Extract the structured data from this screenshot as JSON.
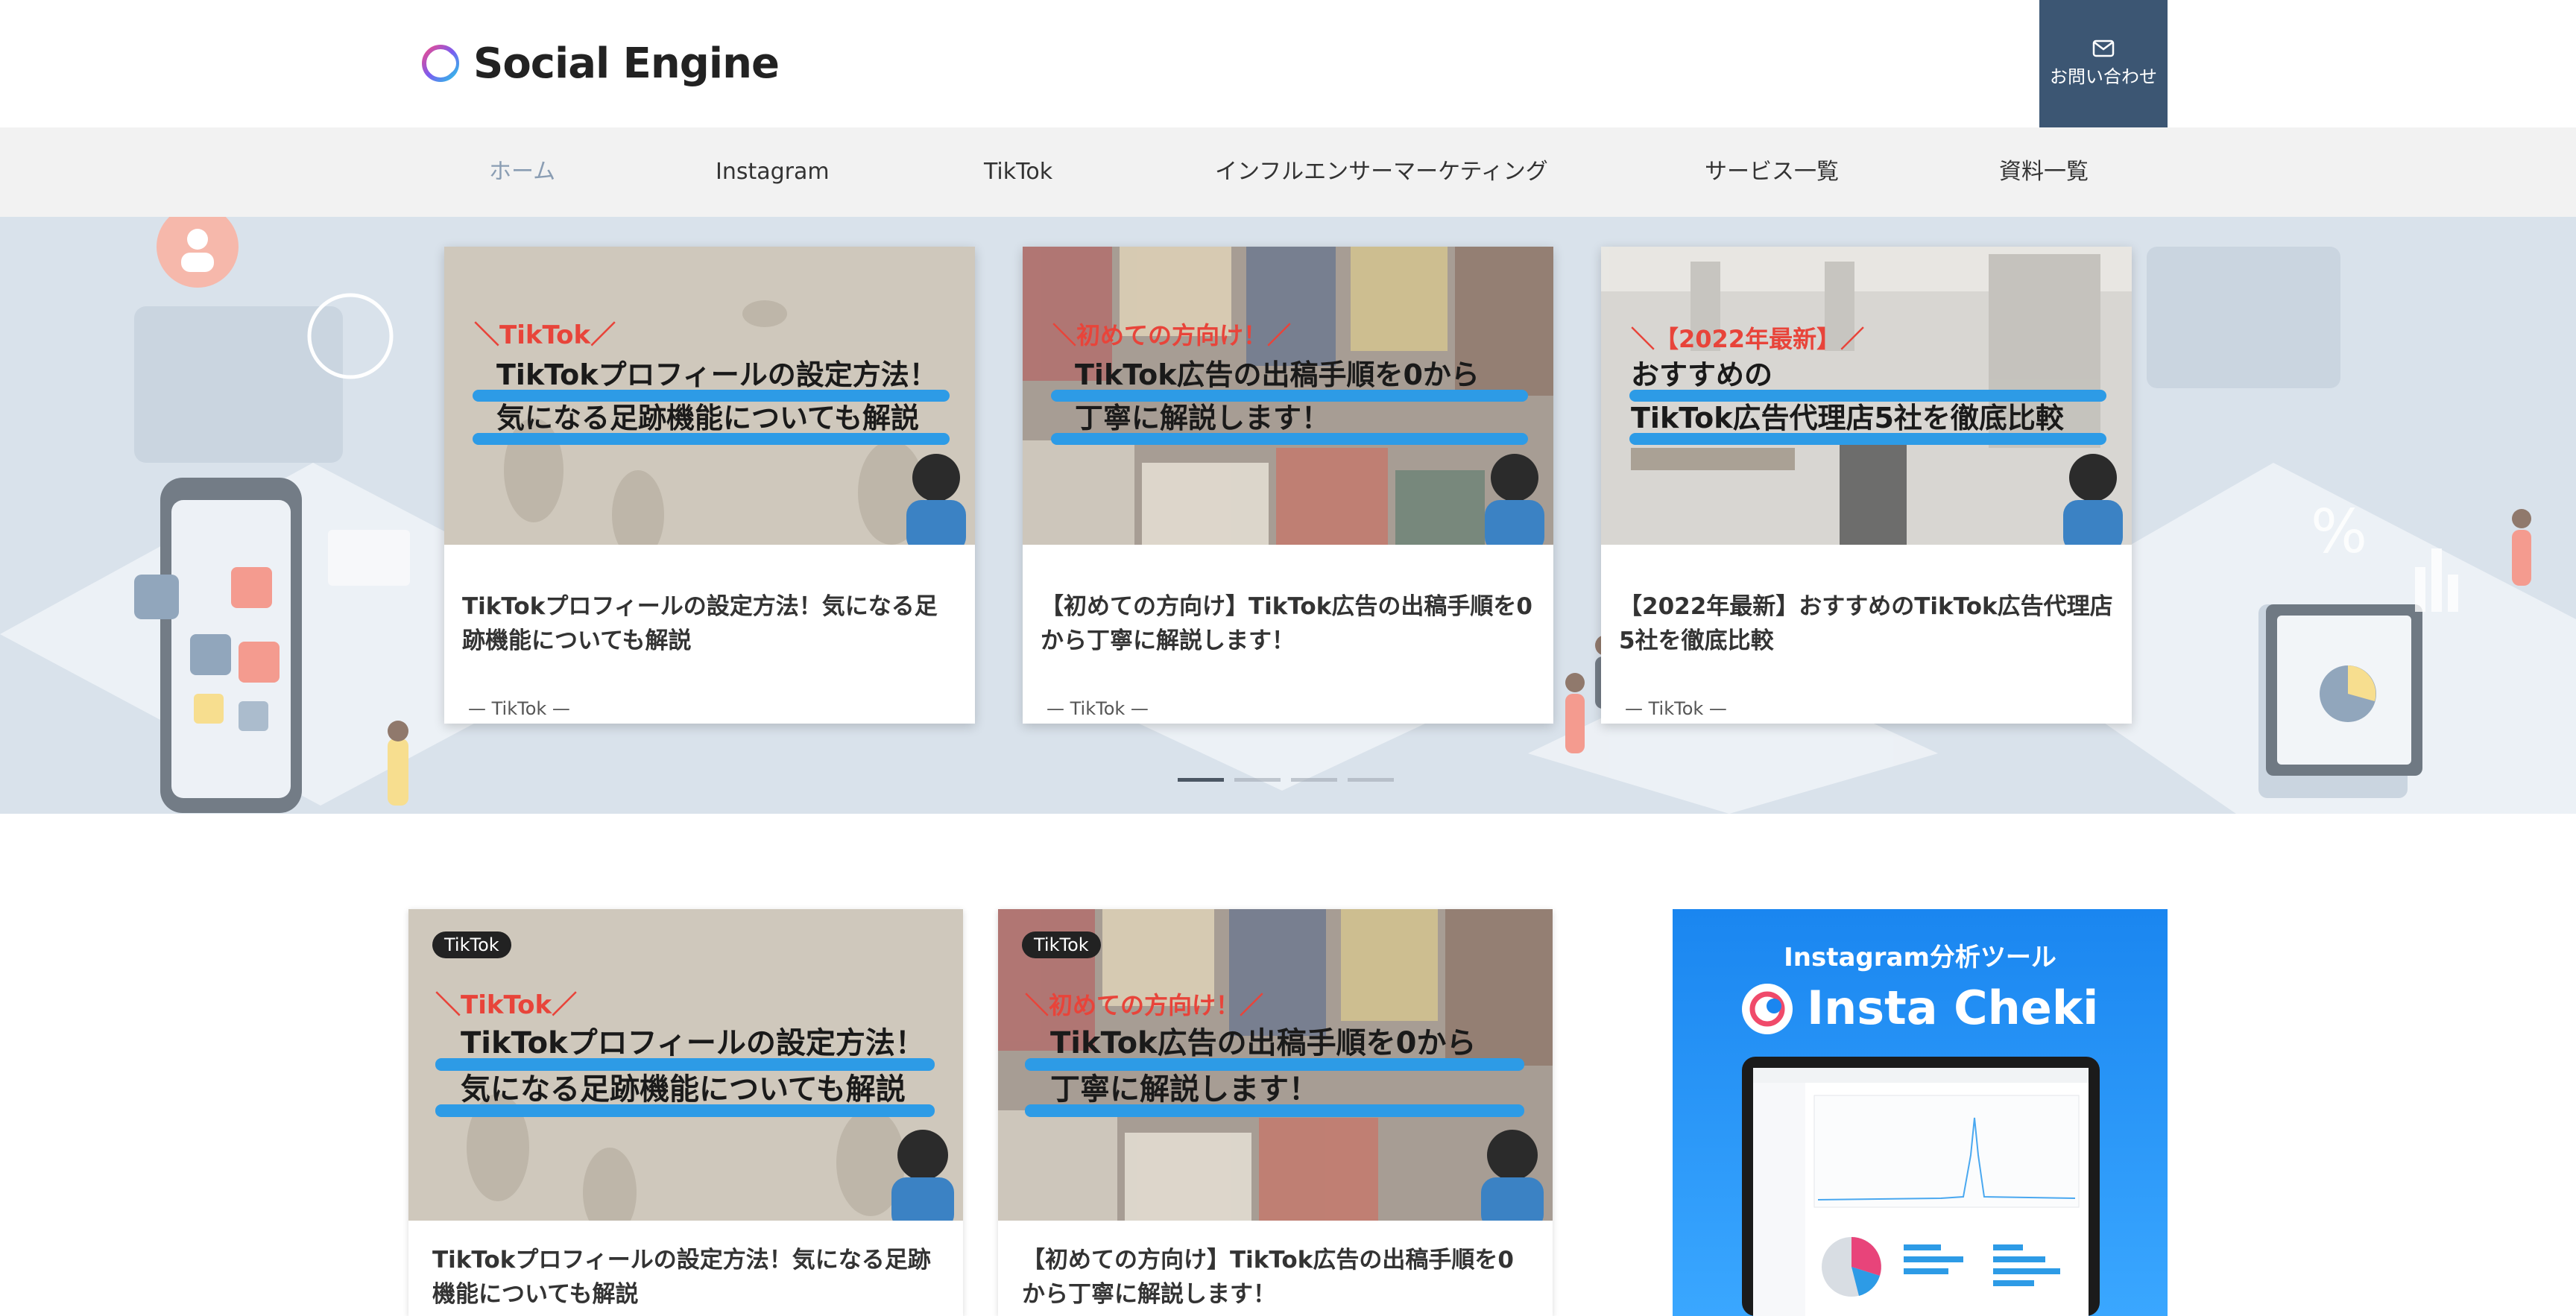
{
  "header": {
    "logo_text": "Social Engine",
    "contact_label": "お問い合わせ"
  },
  "nav": {
    "items": [
      {
        "label": "ホーム",
        "active": true
      },
      {
        "label": "Instagram",
        "active": false
      },
      {
        "label": "TikTok",
        "active": false
      },
      {
        "label": "インフルエンサーマーケティング",
        "active": false
      },
      {
        "label": "サービス一覧",
        "active": false
      },
      {
        "label": "資料一覧",
        "active": false
      }
    ]
  },
  "slider": {
    "active_index": 0,
    "slide_count": 4,
    "cards": [
      {
        "image": {
          "tag": "＼TikTok／",
          "line1": "TikTokプロフィールの設定方法！",
          "line2": "気になる足跡機能についても解説"
        },
        "title": "TikTokプロフィールの設定方法！気になる足跡機能についても解説",
        "category": "— TikTok —"
      },
      {
        "image": {
          "tag": "＼初めての方向け！／",
          "line1": "TikTok広告の出稿手順を0から",
          "line2": "丁寧に解説します！"
        },
        "title": "【初めての方向け】TikTok広告の出稿手順を0から丁寧に解説します！",
        "category": "— TikTok —"
      },
      {
        "image": {
          "tag": "＼【2022年最新】／",
          "line1": "おすすめの",
          "line2": "TikTok広告代理店5社を徹底比較"
        },
        "title": "【2022年最新】おすすめのTikTok広告代理店5社を徹底比較",
        "category": "— TikTok —"
      }
    ]
  },
  "posts": [
    {
      "badge": "TikTok",
      "image": {
        "tag": "＼TikTok／",
        "line1": "TikTokプロフィールの設定方法！",
        "line2": "気になる足跡機能についても解説"
      },
      "title": "TikTokプロフィールの設定方法！気になる足跡機能についても解説"
    },
    {
      "badge": "TikTok",
      "image": {
        "tag": "＼初めての方向け！／",
        "line1": "TikTok広告の出稿手順を0から",
        "line2": "丁寧に解説します！"
      },
      "title": "【初めての方向け】TikTok広告の出稿手順を0から丁寧に解説します！"
    }
  ],
  "ad": {
    "subtitle": "Instagram分析ツール",
    "brand": "Insta Cheki"
  },
  "colors": {
    "accent_blue": "#1d8cf0",
    "contact_bg": "#3c5673",
    "nav_bg": "#f2f2f2",
    "highlight_red": "#e8443a",
    "underline_blue": "#2d9be6"
  }
}
